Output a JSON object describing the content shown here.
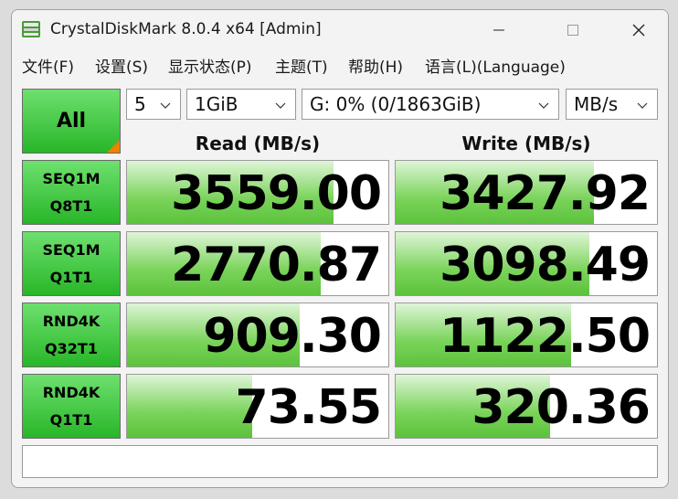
{
  "window": {
    "title": "CrystalDiskMark 8.0.4 x64 [Admin]"
  },
  "menu": [
    {
      "label": "文件(F)"
    },
    {
      "label": "设置(S)"
    },
    {
      "label": "显示状态(P)"
    },
    {
      "label": "主题(T)"
    },
    {
      "label": "帮助(H)"
    },
    {
      "label": "语言(L)(Language)"
    }
  ],
  "controls": {
    "all_label": "All",
    "count": "5",
    "size": "1GiB",
    "drive": "G: 0% (0/1863GiB)",
    "unit": "MB/s"
  },
  "headers": {
    "read": "Read (MB/s)",
    "write": "Write (MB/s)"
  },
  "rows": [
    {
      "line1": "SEQ1M",
      "line2": "Q8T1",
      "read": "3559.00",
      "write": "3427.92",
      "read_fill": 0.79,
      "write_fill": 0.76
    },
    {
      "line1": "SEQ1M",
      "line2": "Q1T1",
      "read": "2770.87",
      "write": "3098.49",
      "read_fill": 0.74,
      "write_fill": 0.74
    },
    {
      "line1": "RND4K",
      "line2": "Q32T1",
      "read": "909.30",
      "write": "1122.50",
      "read_fill": 0.66,
      "write_fill": 0.67
    },
    {
      "line1": "RND4K",
      "line2": "Q1T1",
      "read": "73.55",
      "write": "320.36",
      "read_fill": 0.48,
      "write_fill": 0.59
    }
  ],
  "status": {
    "text": ""
  },
  "colors": {
    "accent_green": "#28b628",
    "corner_orange": "#f08000"
  }
}
